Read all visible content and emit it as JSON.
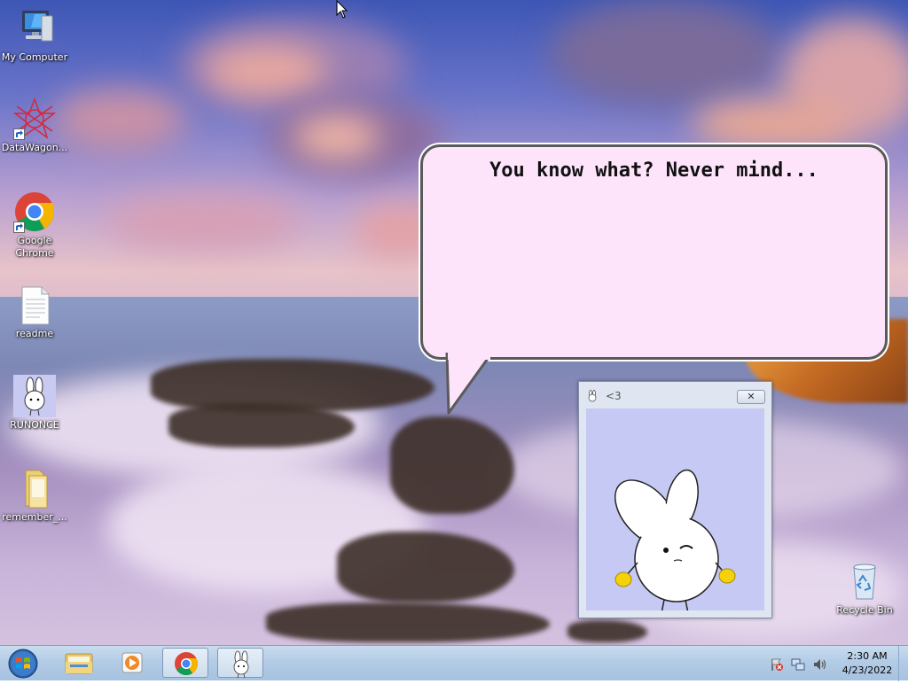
{
  "desktop": {
    "icons": [
      {
        "label": "My Computer"
      },
      {
        "label": "DataWagon..."
      },
      {
        "label": "Google Chrome"
      },
      {
        "label": "readme"
      },
      {
        "label": "RUNONCE"
      },
      {
        "label": "remember_..."
      },
      {
        "label": "Recycle Bin"
      }
    ]
  },
  "bubble": {
    "text": "You know what? Never mind..."
  },
  "pet_window": {
    "title": "<3",
    "close_glyph": "✕"
  },
  "taskbar": {
    "pinned": [
      "start-orb-icon",
      "file-explorer-icon",
      "media-player-icon",
      "chrome-icon",
      "bunny-app-icon"
    ],
    "clock_time": "2:30 AM",
    "clock_date": "4/23/2022"
  },
  "colors": {
    "bubble_fill": "#fde4fb",
    "pet_background": "#c6c9f3",
    "taskbar": "#b3cce6"
  }
}
